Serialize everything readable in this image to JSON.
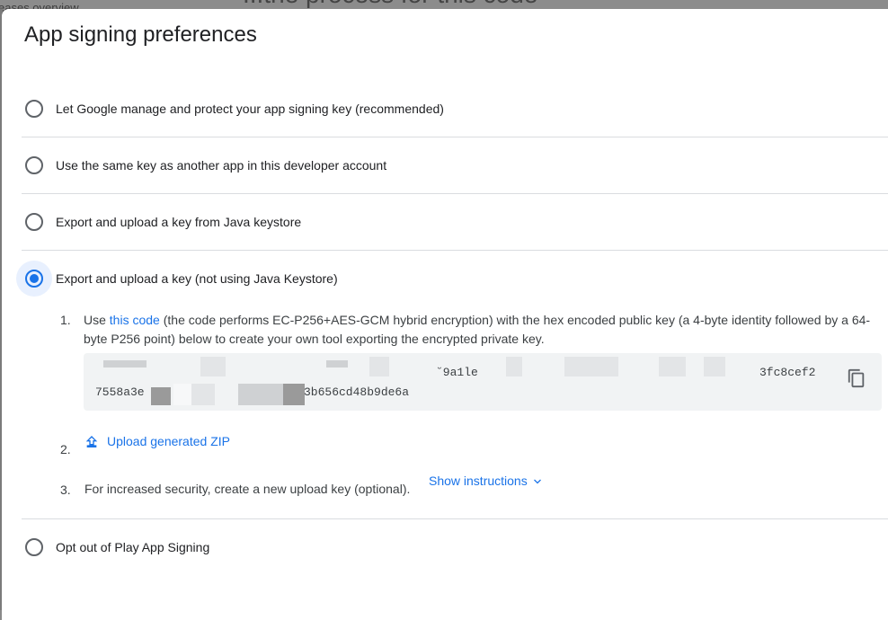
{
  "background": {
    "breadcrumb_text": "eases overview",
    "heading_text": "...the process for this code"
  },
  "dialog": {
    "title": "App signing preferences",
    "options": [
      {
        "label": "Let Google manage and protect your app signing key (recommended)",
        "selected": false
      },
      {
        "label": "Use the same key as another app in this developer account",
        "selected": false
      },
      {
        "label": "Export and upload a key from Java keystore",
        "selected": false
      },
      {
        "label": "Export and upload a key (not using Java Keystore)",
        "selected": true
      },
      {
        "label": "Opt out of Play App Signing",
        "selected": false
      }
    ],
    "steps": {
      "step1": {
        "number": "1.",
        "prefix": "Use ",
        "link": "this code",
        "suffix": " (the code performs EC-P256+AES-GCM hybrid encryption) with the hex encoded public key (a 4-byte identity followed by a 64-byte P256 point) below to create your own tool exporting the encrypted private key.",
        "key_line1_part1": "˘9a1le",
        "key_line1_part2": "3fc8cef2",
        "key_line2_part1": "7558a3e",
        "key_line2_part2": "3b656cd48b9de6a",
        "copy_icon": "copy-icon"
      },
      "step2": {
        "number": "2.",
        "label": "Upload generated ZIP",
        "icon": "upload-icon"
      },
      "step3": {
        "number": "3.",
        "text": "For increased security, create a new upload key (optional).",
        "link": "Show instructions",
        "icon": "chevron-down-icon"
      }
    }
  },
  "colors": {
    "accent": "#1a73e8",
    "selected_bg": "#e8f0fe",
    "keybox_bg": "#f1f3f4",
    "divider": "#dadce0"
  }
}
